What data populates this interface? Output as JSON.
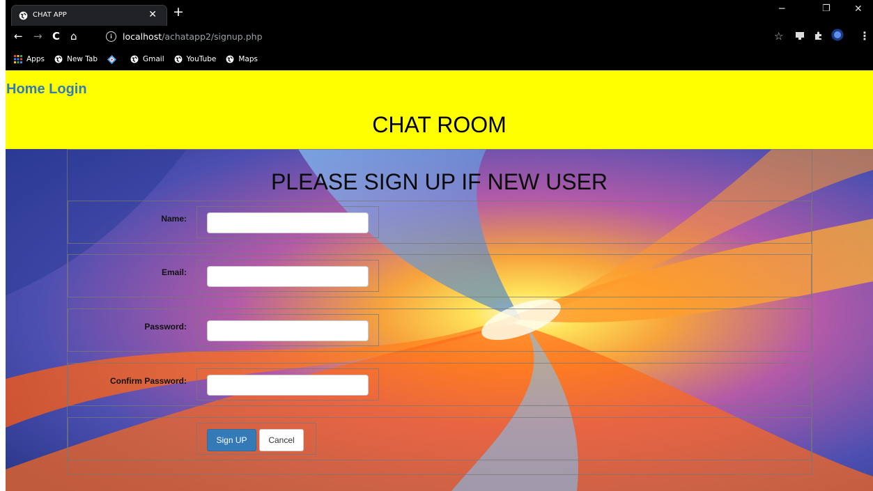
{
  "browser": {
    "tab_title": "CHAT APP",
    "url_host": "localhost",
    "url_path": "/achatapp2/signup.php",
    "bookmarks": [
      {
        "label": "Apps",
        "icon": "apps-grid-icon"
      },
      {
        "label": "New Tab",
        "icon": "globe-icon"
      },
      {
        "label": "",
        "icon": "diamond-icon"
      },
      {
        "label": "Gmail",
        "icon": "globe-icon"
      },
      {
        "label": "YouTube",
        "icon": "globe-icon"
      },
      {
        "label": "Maps",
        "icon": "globe-icon"
      }
    ]
  },
  "header": {
    "nav_home": "Home",
    "nav_login": "Login",
    "title": "CHAT ROOM",
    "bg_color": "#ffff00",
    "link_color": "#337ab7"
  },
  "form": {
    "title": "PLEASE SIGN UP IF NEW USER",
    "fields": [
      {
        "label": "Name:",
        "value": ""
      },
      {
        "label": "Email:",
        "value": ""
      },
      {
        "label": "Password:",
        "value": ""
      },
      {
        "label": "Confirm Password:",
        "value": ""
      }
    ],
    "submit_label": "Sign UP",
    "cancel_label": "Cancel",
    "submit_color": "#337ab7"
  }
}
